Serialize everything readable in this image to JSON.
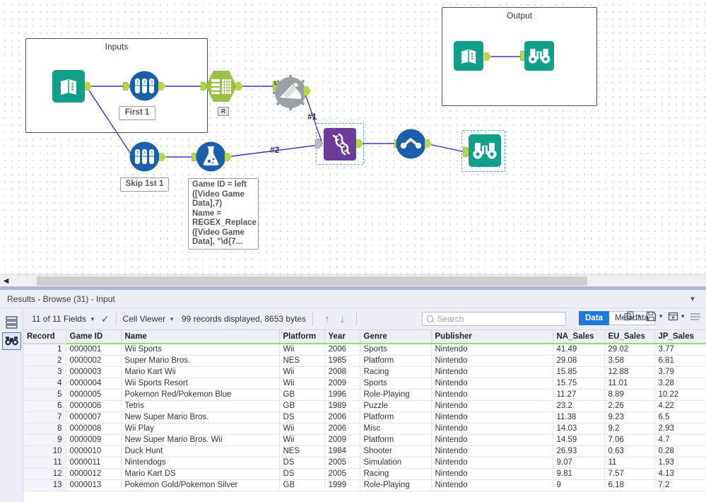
{
  "canvas": {
    "containers": [
      {
        "title": "Inputs"
      },
      {
        "title": "Output"
      }
    ],
    "annotations": [
      {
        "id": "first1",
        "text": "First 1"
      },
      {
        "id": "skip1st1",
        "text": "Skip 1st 1"
      },
      {
        "id": "formula",
        "text": "Game ID = left\n([Video Game\nData],7)\nName =\nREGEX_Replace\n([Video Game\nData], \"\\d{7..."
      }
    ],
    "port_labels": [
      {
        "id": "hash1",
        "text": "#1"
      },
      {
        "id": "hash2",
        "text": "#2"
      },
      {
        "id": "join-l",
        "text": "L"
      },
      {
        "id": "join-r",
        "text": "R"
      }
    ],
    "tools": [
      {
        "id": "input-data-1",
        "name": "input-data-tool"
      },
      {
        "id": "sample-1",
        "name": "sample-tool"
      },
      {
        "id": "select-1",
        "name": "select-tool"
      },
      {
        "id": "join-1",
        "name": "join-tool"
      },
      {
        "id": "sample-2",
        "name": "sample-tool"
      },
      {
        "id": "formula-1",
        "name": "formula-tool"
      },
      {
        "id": "union-1",
        "name": "union-tool"
      },
      {
        "id": "sort-1",
        "name": "sort-tool"
      },
      {
        "id": "browse-1",
        "name": "browse-tool"
      },
      {
        "id": "input-data-2",
        "name": "input-data-tool"
      },
      {
        "id": "browse-2",
        "name": "browse-tool"
      }
    ]
  },
  "results": {
    "title": "Results - Browse (31) - Input",
    "collapse_icon": "chevron-down-icon",
    "sidebar": [
      {
        "id": "all-results",
        "icon": "layers-icon",
        "selected": false
      },
      {
        "id": "browse-results",
        "icon": "binoculars-icon",
        "selected": true
      }
    ],
    "toolbar": {
      "fields_label": "11 of 11 Fields",
      "cell_viewer_label": "Cell Viewer",
      "record_status": "99 records displayed, 8653 bytes",
      "search_placeholder": "Search",
      "search_value": "",
      "data_tab": "Data",
      "metadata_tab": "Metadata",
      "active_tab": "Data",
      "icons": [
        "copy-icon",
        "save-icon",
        "add-column-icon",
        "menu-icon"
      ],
      "up_arrow": "↑",
      "down_arrow": "↓",
      "check": "✓"
    }
  },
  "chart_data": {
    "type": "table",
    "title": "Results - Browse (31) - Input",
    "columns": [
      "Record",
      "Game ID",
      "Name",
      "Platform",
      "Year",
      "Genre",
      "Publisher",
      "NA_Sales",
      "EU_Sales",
      "JP_Sales"
    ],
    "rows": [
      [
        "1",
        "0000001",
        "Wii Sports",
        "Wii",
        "2006",
        "Sports",
        "Nintendo",
        "41.49",
        "29.02",
        "3.77"
      ],
      [
        "2",
        "0000002",
        "Super Mario Bros.",
        "NES",
        "1985",
        "Platform",
        "Nintendo",
        "29.08",
        "3.58",
        "6.81"
      ],
      [
        "3",
        "0000003",
        "Mario Kart Wii",
        "Wii",
        "2008",
        "Racing",
        "Nintendo",
        "15.85",
        "12.88",
        "3.79"
      ],
      [
        "4",
        "0000004",
        "Wii Sports Resort",
        "Wii",
        "2009",
        "Sports",
        "Nintendo",
        "15.75",
        "11.01",
        "3.28"
      ],
      [
        "5",
        "0000005",
        "Pokemon Red/Pokemon Blue",
        "GB",
        "1996",
        "Role-Playing",
        "Nintendo",
        "11.27",
        "8.89",
        "10.22"
      ],
      [
        "6",
        "0000006",
        "Tetris",
        "GB",
        "1989",
        "Puzzle",
        "Nintendo",
        "23.2",
        "2.26",
        "4.22"
      ],
      [
        "7",
        "0000007",
        "New Super Mario Bros.",
        "DS",
        "2006",
        "Platform",
        "Nintendo",
        "11.38",
        "9.23",
        "6.5"
      ],
      [
        "8",
        "0000008",
        "Wii Play",
        "Wii",
        "2006",
        "Misc",
        "Nintendo",
        "14.03",
        "9.2",
        "2.93"
      ],
      [
        "9",
        "0000009",
        "New Super Mario Bros. Wii",
        "Wii",
        "2009",
        "Platform",
        "Nintendo",
        "14.59",
        "7.06",
        "4.7"
      ],
      [
        "10",
        "0000010",
        "Duck Hunt",
        "NES",
        "1984",
        "Shooter",
        "Nintendo",
        "26.93",
        "0.63",
        "0.28"
      ],
      [
        "11",
        "0000011",
        "Nintendogs",
        "DS",
        "2005",
        "Simulation",
        "Nintendo",
        "9.07",
        "11",
        "1.93"
      ],
      [
        "12",
        "0000012",
        "Mario Kart DS",
        "DS",
        "2005",
        "Racing",
        "Nintendo",
        "9.81",
        "7.57",
        "4.13"
      ],
      [
        "13",
        "0000013",
        "Pokemon Gold/Pokemon Silver",
        "GB",
        "1999",
        "Role-Playing",
        "Nintendo",
        "9",
        "6.18",
        "7.2"
      ]
    ]
  },
  "colors": {
    "teal": "#10a08a",
    "blue": "#1b5faa",
    "green": "#9bbf43",
    "gray": "#9aa0a6",
    "purple": "#6b3d99",
    "accent_blue": "#1f7ae0",
    "wire": "#3a32c8",
    "port_green": "#b2d84a",
    "header_green": "#8ce35c"
  }
}
